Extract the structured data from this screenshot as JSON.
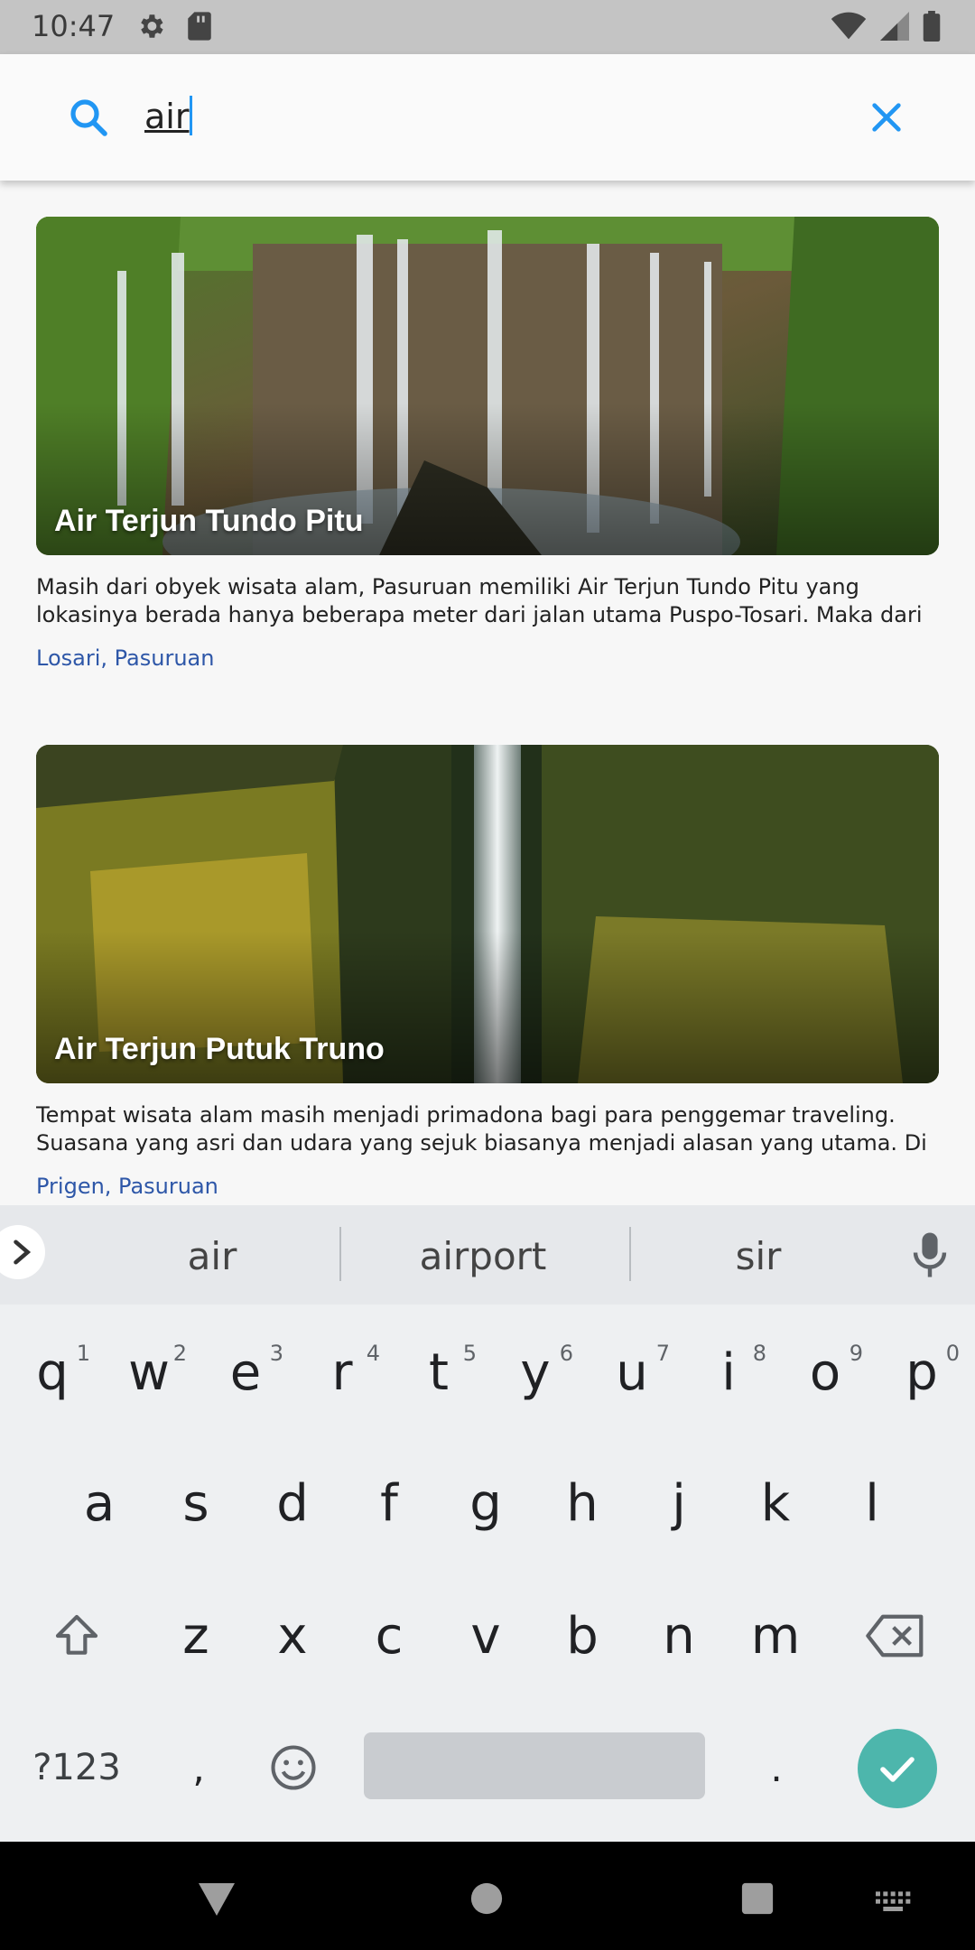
{
  "status_bar": {
    "time": "10:47"
  },
  "search": {
    "value": "air"
  },
  "results": [
    {
      "title": "Air Terjun Tundo Pitu",
      "description": "Masih dari obyek wisata alam, Pasuruan memiliki Air Terjun Tundo Pitu yang lokasinya berada hanya beberapa meter dari jalan utama Puspo-Tosari. Maka dari",
      "location": "Losari, Pasuruan"
    },
    {
      "title": "Air Terjun Putuk Truno",
      "description": "Tempat wisata alam masih menjadi primadona bagi para penggemar traveling. Suasana yang asri dan udara yang sejuk biasanya menjadi alasan yang utama. Di",
      "location": "Prigen, Pasuruan"
    }
  ],
  "keyboard": {
    "suggestions": [
      "air",
      "airport",
      "sir"
    ],
    "row1": [
      "q",
      "w",
      "e",
      "r",
      "t",
      "y",
      "u",
      "i",
      "o",
      "p"
    ],
    "row1_nums": [
      "1",
      "2",
      "3",
      "4",
      "5",
      "6",
      "7",
      "8",
      "9",
      "0"
    ],
    "row2": [
      "a",
      "s",
      "d",
      "f",
      "g",
      "h",
      "j",
      "k",
      "l"
    ],
    "row3": [
      "z",
      "x",
      "c",
      "v",
      "b",
      "n",
      "m"
    ],
    "symbols_label": "?123",
    "comma": ",",
    "period": "."
  },
  "colors": {
    "accent": "#2196f3",
    "link": "#2e57a8",
    "enter": "#4db6ac"
  }
}
